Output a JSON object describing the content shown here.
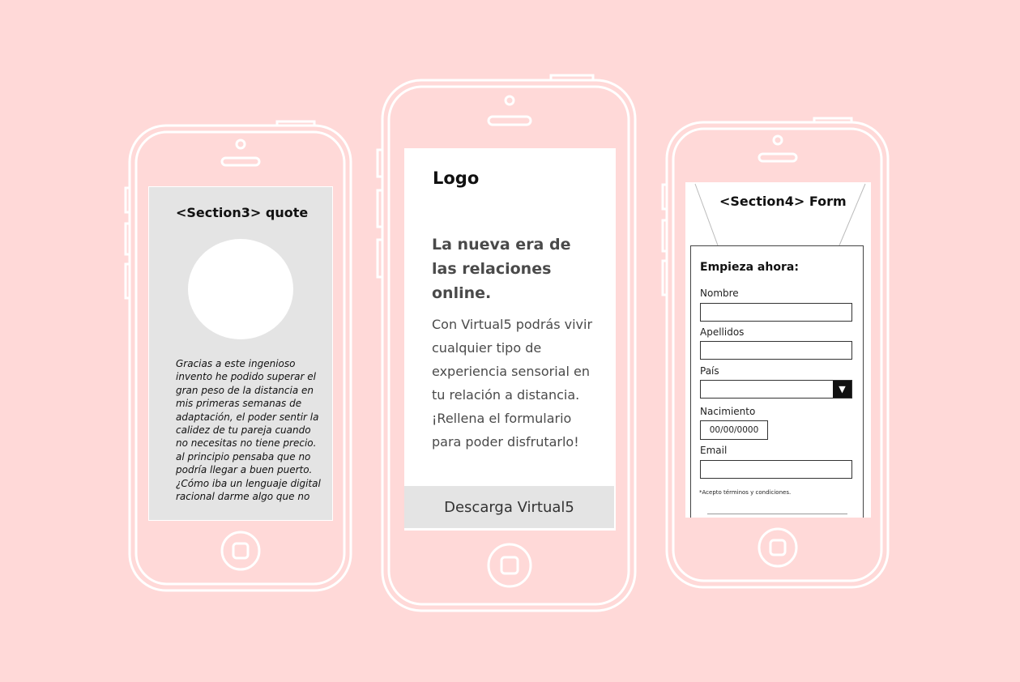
{
  "colors": {
    "background": "#ffd9d8",
    "screen_gray": "#e4e4e4",
    "outline": "#ffffff"
  },
  "left_phone": {
    "title": "<Section3> quote",
    "quote": "Gracias a este ingenioso invento he podido superar el gran peso  de la distancia en mis primeras semanas de adaptación, el poder sentir la calidez  de tu pareja cuando no necesitas no tiene precio. al principio pensaba que no  podría llegar a buen puerto. ¿Cómo iba un lenguaje digital racional darme algo que no"
  },
  "center_phone": {
    "logo": "Logo",
    "headline": "La nueva era de las relaciones online.",
    "body": "Con Virtual5 podrás vivir cualquier tipo de experiencia sensorial en tu relación a distancia. ¡Rellena el formulario para poder disfrutarlo!",
    "cta": "Descarga Virtual5"
  },
  "right_phone": {
    "title": "<Section4> Form",
    "form_title": "Empieza ahora:",
    "fields": {
      "nombre": {
        "label": "Nombre",
        "value": ""
      },
      "apellidos": {
        "label": "Apellidos",
        "value": ""
      },
      "pais": {
        "label": "País",
        "value": "",
        "icon": "triangle-down-icon"
      },
      "nacimiento": {
        "label": "Nacimiento",
        "value": "00/00/0000"
      },
      "email": {
        "label": "Email",
        "value": ""
      }
    },
    "terms": "*Acepto términos y condiciones."
  }
}
